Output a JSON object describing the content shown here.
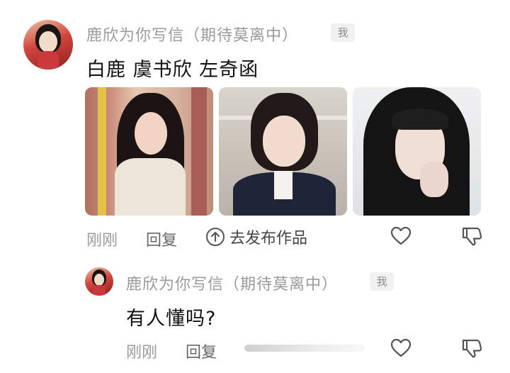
{
  "comment1": {
    "username": "鹿欣为你写信（期待莫离中）",
    "badge": "我",
    "text": "白鹿  虞书欣 左奇函",
    "time": "刚刚",
    "reply_label": "回复",
    "publish_label": "去发布作品"
  },
  "comment2": {
    "username": "鹿欣为你写信（期待莫离中）",
    "badge": "我",
    "text": "有人懂吗?",
    "time": "刚刚",
    "reply_label": "回复"
  },
  "icons": {
    "like": "heart-outline-icon",
    "dislike": "thumbs-down-outline-icon",
    "publish": "arrow-up-circle-icon"
  },
  "colors": {
    "meta_text": "#9a9a9a",
    "icon_gray": "#555555"
  }
}
